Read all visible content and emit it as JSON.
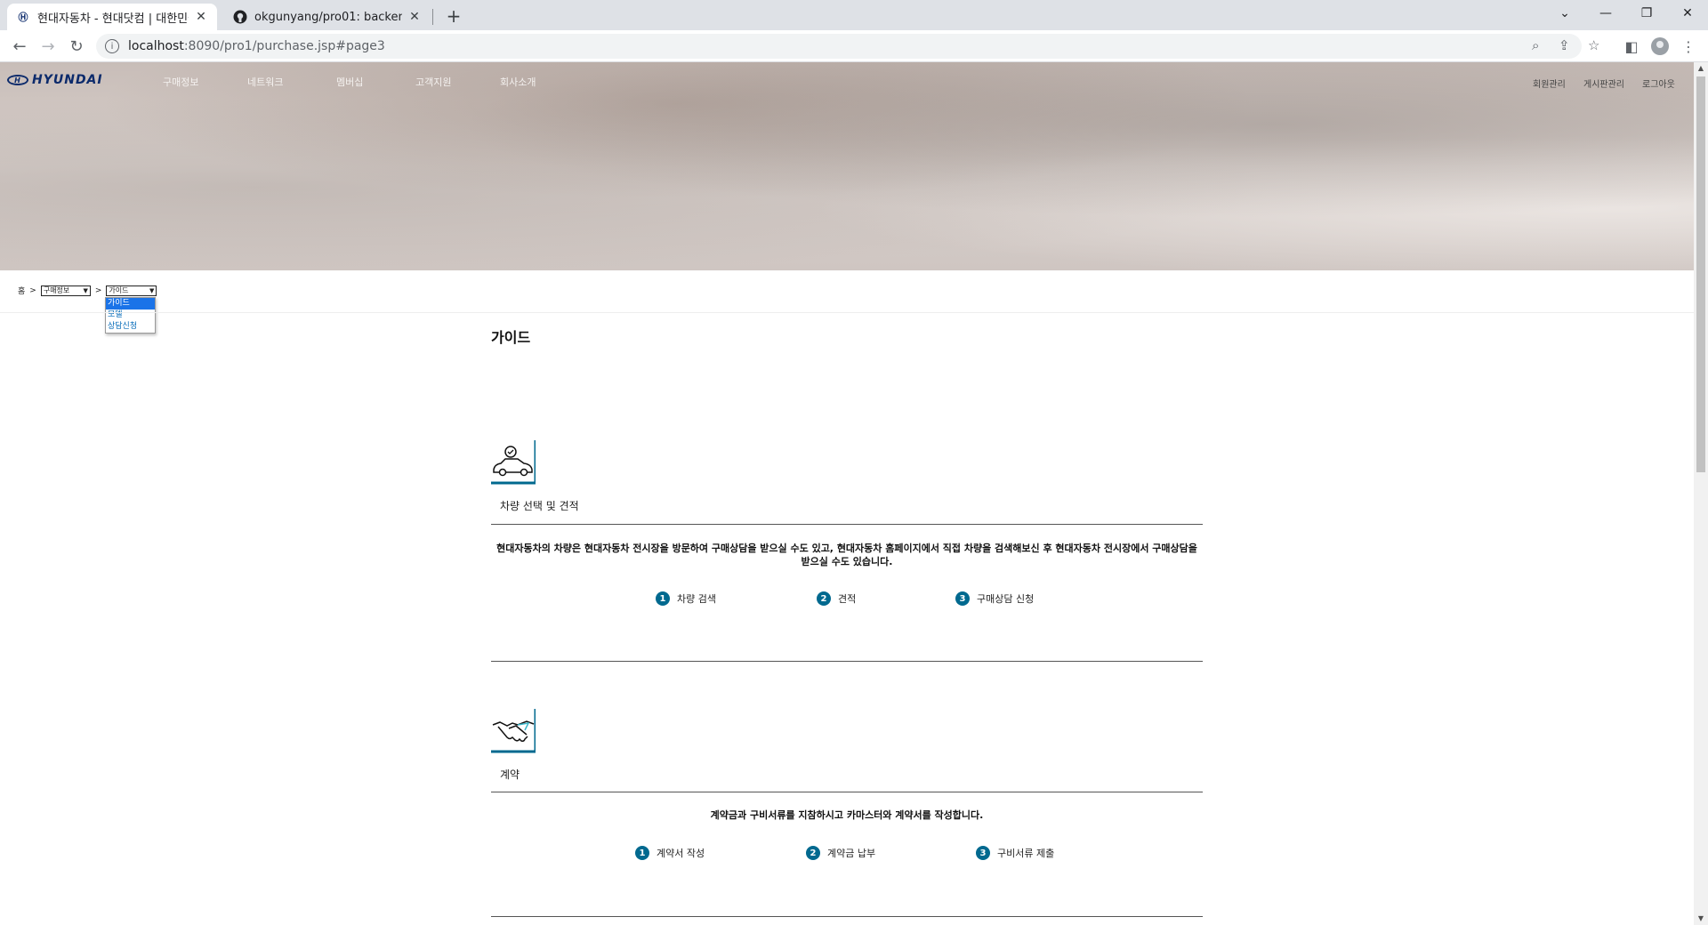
{
  "browser": {
    "tabs": [
      {
        "title": "현대자동차 - 현대닷컴 | 대한민국",
        "close": "✕",
        "favicon": "hyundai-icon"
      },
      {
        "title": "okgunyang/pro01: backend proj",
        "close": "✕",
        "favicon": "github-icon"
      }
    ],
    "new_tab": "+",
    "address": {
      "host": "localhost",
      "path": ":8090/pro1/purchase.jsp#page3"
    }
  },
  "site": {
    "logo": "HYUNDAI",
    "nav": [
      "구매정보",
      "네트워크",
      "멤버십",
      "고객지원",
      "회사소개"
    ],
    "util": [
      "회원관리",
      "게시판관리",
      "로그아웃"
    ]
  },
  "breadcrumb": {
    "home": "홈",
    "sep": ">",
    "level1": "구매정보",
    "level2": "가이드",
    "options": [
      "가이드",
      "모델",
      "상담신청"
    ]
  },
  "content": {
    "title": "가이드",
    "steps": [
      {
        "name": "차량 선택 및 견적",
        "icon": "car-icon",
        "desc": "현대자동차의 차량은 현대자동차 전시장을 방문하여 구매상담을 받으실 수도 있고, 현대자동차 홈페이지에서 직접 차량을 검색해보신 후 현대자동차 전시장에서 구매상담을 받으실 수도 있습니다.",
        "substeps": [
          {
            "num": "1",
            "label": "차량 검색"
          },
          {
            "num": "2",
            "label": "견적"
          },
          {
            "num": "3",
            "label": "구매상담 신청"
          }
        ]
      },
      {
        "name": "계약",
        "icon": "handshake-icon",
        "desc": "계약금과 구비서류를 지참하시고 카마스터와 계약서를 작성합니다.",
        "substeps": [
          {
            "num": "1",
            "label": "계약서 작성"
          },
          {
            "num": "2",
            "label": "계약금 납부"
          },
          {
            "num": "3",
            "label": "구비서류 제출"
          }
        ]
      }
    ]
  },
  "colors": {
    "accent": "#00698f",
    "logo": "#0b2a6b"
  }
}
